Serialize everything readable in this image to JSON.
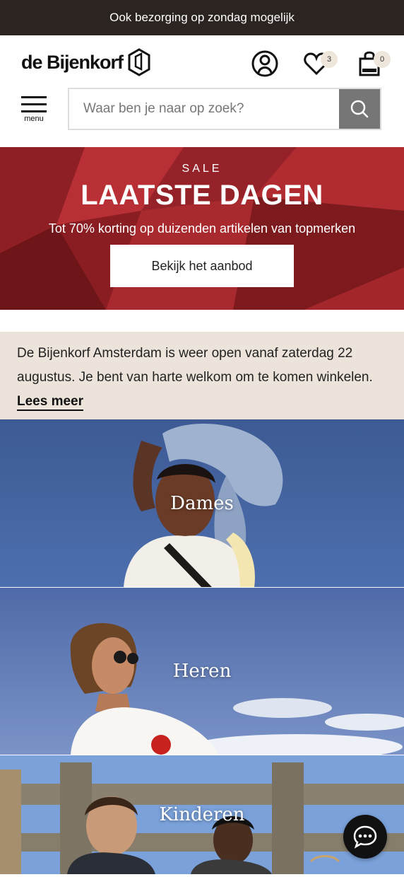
{
  "topbar": {
    "text": "Ook bezorging op zondag mogelijk"
  },
  "header": {
    "logo_text": "de Bijenkorf",
    "wishlist_count": "3",
    "cart_count": "0",
    "menu_label": "menu"
  },
  "search": {
    "placeholder": "Waar ben je naar op zoek?"
  },
  "sale": {
    "label": "SALE",
    "title": "LAATSTE DAGEN",
    "subtitle": "Tot 70% korting op duizenden artikelen van topmerken",
    "cta": "Bekijk het aanbod"
  },
  "notice": {
    "text": "De Bijenkorf Amsterdam is weer open vanaf zaterdag 22 augustus. Je bent van harte welkom om te komen winkelen.",
    "link": "Lees meer"
  },
  "categories": [
    {
      "label": "Dames"
    },
    {
      "label": "Heren"
    },
    {
      "label": "Kinderen"
    }
  ],
  "colors": {
    "topbar": "#2b2420",
    "sale": "#a3262b",
    "notice": "#ece4da",
    "search_button": "#767676"
  },
  "icons": [
    "hexagon-logo-icon",
    "account-icon",
    "heart-icon",
    "shopping-bag-icon",
    "menu-icon",
    "search-icon",
    "chat-icon"
  ]
}
